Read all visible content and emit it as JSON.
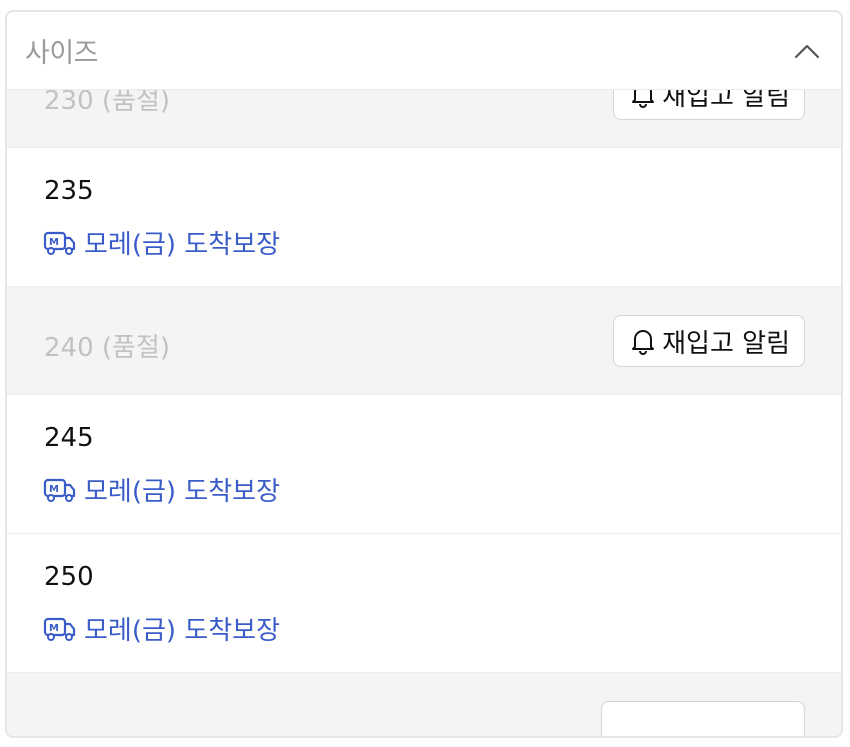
{
  "header": {
    "title": "사이즈",
    "toggle_icon": "chevron-up-icon"
  },
  "sizes": [
    {
      "label": "230 (품절)",
      "status": "soldout",
      "action": "재입고 알림"
    },
    {
      "label": "235",
      "status": "available",
      "delivery": "모레(금) 도착보장"
    },
    {
      "label": "240 (품절)",
      "status": "soldout",
      "action": "재입고 알림"
    },
    {
      "label": "245",
      "status": "available",
      "delivery": "모레(금) 도착보장"
    },
    {
      "label": "250",
      "status": "available",
      "delivery": "모레(금) 도착보장"
    }
  ],
  "colors": {
    "accent": "#3a5cc8",
    "soldout_bg": "#f4f4f4",
    "soldout_text": "#c2c2c2",
    "header_text": "#9a9a9a"
  }
}
